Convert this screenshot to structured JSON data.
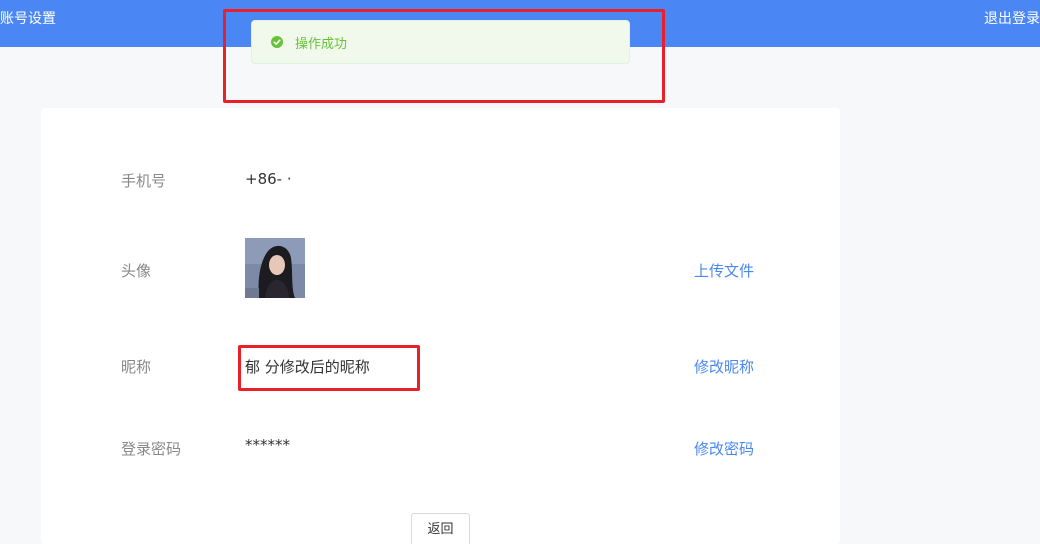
{
  "header": {
    "title": "账号设置",
    "logout_label": "退出登录"
  },
  "toast": {
    "message": "操作成功",
    "icon": "check-circle-icon",
    "color": "#67c23a"
  },
  "profile": {
    "phone": {
      "label": "手机号",
      "value": "+86-  ·"
    },
    "avatar": {
      "label": "头像",
      "action": "上传文件"
    },
    "nickname": {
      "label": "昵称",
      "value": "郁 分修改后的昵称",
      "action": "修改昵称"
    },
    "password": {
      "label": "登录密码",
      "value": "******",
      "action": "修改密码"
    }
  },
  "back_label": "返回",
  "colors": {
    "accent": "#4a87f5",
    "success": "#67c23a",
    "highlight": "#e8202a"
  }
}
